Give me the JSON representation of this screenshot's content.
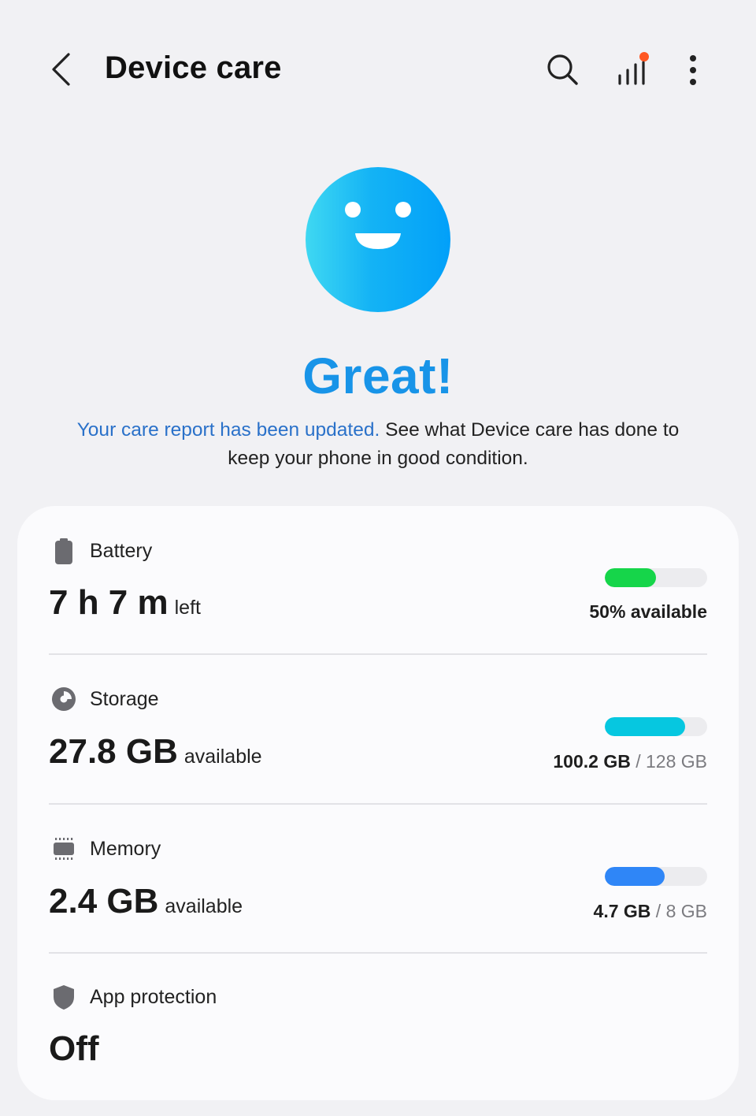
{
  "header": {
    "title": "Device care"
  },
  "status": {
    "label": "Great!",
    "desc_link": "Your care report has been updated.",
    "desc_rest": " See what Device care has done to keep your phone in good condition.",
    "face_color": "#14b3f5",
    "status_color": "#1894e8"
  },
  "items": {
    "battery": {
      "label": "Battery",
      "value": "7 h 7 m",
      "suffix": "left",
      "right_label": "50% available",
      "progress": 0.5,
      "bar_color": "#16d54a"
    },
    "storage": {
      "label": "Storage",
      "value": "27.8 GB",
      "suffix": "available",
      "used": "100.2 GB",
      "sep": " / ",
      "total": "128 GB",
      "progress": 0.783,
      "bar_color": "#06c7e0"
    },
    "memory": {
      "label": "Memory",
      "value": "2.4 GB",
      "suffix": "available",
      "used": "4.7 GB",
      "sep": " / ",
      "total": "8 GB",
      "progress": 0.5875,
      "bar_color": "#2f86f7"
    },
    "app_protection": {
      "label": "App protection",
      "value": "Off"
    }
  },
  "icons": {
    "back": "chevron-left-icon",
    "search": "search-icon",
    "stats": "bar-chart-icon",
    "more": "more-vertical-icon",
    "face": "smiley-face-icon",
    "battery": "battery-icon",
    "storage": "pie-chart-icon",
    "memory": "memory-chip-icon",
    "shield": "shield-icon",
    "notification_dot_color": "#ff5722"
  }
}
